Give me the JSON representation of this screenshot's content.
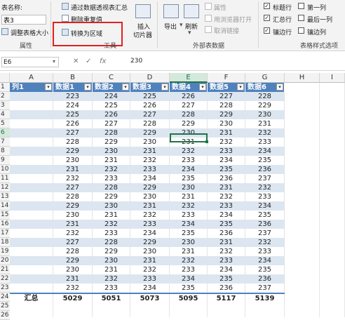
{
  "ribbon": {
    "table_name_label": "表名称:",
    "table_name_value": "表3",
    "resize_label": "调整表格大小",
    "group_properties": "属性",
    "summarize_pivot": "通过数据透视表汇总",
    "remove_duplicates": "删除重复值",
    "convert_to_range": "转换为区域",
    "group_tools": "工具",
    "insert_slicer_line1": "插入",
    "insert_slicer_line2": "切片器",
    "export_label": "导出",
    "refresh_label": "刷新",
    "properties_label": "属性",
    "open_in_browser": "用浏览器打开",
    "unlink_label": "取消链接",
    "group_external": "外部表数据",
    "opt_header_row": "标题行",
    "opt_total_row": "汇总行",
    "opt_banded_rows": "镶边行",
    "opt_first_column": "第一列",
    "opt_last_column": "最后一列",
    "opt_banded_columns": "镶边列",
    "group_style_options": "表格样式选项"
  },
  "formula_bar": {
    "name_box": "E6",
    "fx": "fx",
    "value": "230"
  },
  "columns": [
    "A",
    "B",
    "C",
    "D",
    "E",
    "F",
    "G",
    "H",
    "I"
  ],
  "row_numbers": [
    "1",
    "2",
    "3",
    "4",
    "5",
    "6",
    "7",
    "8",
    "9",
    "10",
    "11",
    "12",
    "13",
    "14",
    "15",
    "16",
    "17",
    "18",
    "19",
    "20",
    "21",
    "22",
    "23",
    "24",
    "25",
    "26"
  ],
  "table": {
    "headers": [
      "列1",
      "数据1",
      "数据2",
      "数据3",
      "数据4",
      "数据5",
      "数据6"
    ],
    "rows": [
      [
        "",
        "223",
        "224",
        "225",
        "226",
        "227",
        "228"
      ],
      [
        "",
        "224",
        "225",
        "226",
        "227",
        "228",
        "229"
      ],
      [
        "",
        "225",
        "226",
        "227",
        "228",
        "229",
        "230"
      ],
      [
        "",
        "226",
        "227",
        "228",
        "229",
        "230",
        "231"
      ],
      [
        "",
        "227",
        "228",
        "229",
        "230",
        "231",
        "232"
      ],
      [
        "",
        "228",
        "229",
        "230",
        "231",
        "232",
        "233"
      ],
      [
        "",
        "229",
        "230",
        "231",
        "232",
        "233",
        "234"
      ],
      [
        "",
        "230",
        "231",
        "232",
        "233",
        "234",
        "235"
      ],
      [
        "",
        "231",
        "232",
        "233",
        "234",
        "235",
        "236"
      ],
      [
        "",
        "232",
        "233",
        "234",
        "235",
        "236",
        "237"
      ],
      [
        "",
        "227",
        "228",
        "229",
        "230",
        "231",
        "232"
      ],
      [
        "",
        "228",
        "229",
        "230",
        "231",
        "232",
        "233"
      ],
      [
        "",
        "229",
        "230",
        "231",
        "232",
        "233",
        "234"
      ],
      [
        "",
        "230",
        "231",
        "232",
        "233",
        "234",
        "235"
      ],
      [
        "",
        "231",
        "232",
        "233",
        "234",
        "235",
        "236"
      ],
      [
        "",
        "232",
        "233",
        "234",
        "235",
        "236",
        "237"
      ],
      [
        "",
        "227",
        "228",
        "229",
        "230",
        "231",
        "232"
      ],
      [
        "",
        "228",
        "229",
        "230",
        "231",
        "232",
        "233"
      ],
      [
        "",
        "229",
        "230",
        "231",
        "232",
        "233",
        "234"
      ],
      [
        "",
        "230",
        "231",
        "232",
        "233",
        "234",
        "235"
      ],
      [
        "",
        "231",
        "232",
        "233",
        "234",
        "235",
        "236"
      ],
      [
        "",
        "232",
        "233",
        "234",
        "235",
        "236",
        "237"
      ]
    ],
    "total_row": [
      "汇总",
      "5029",
      "5051",
      "5073",
      "5095",
      "5117",
      "5139"
    ]
  }
}
